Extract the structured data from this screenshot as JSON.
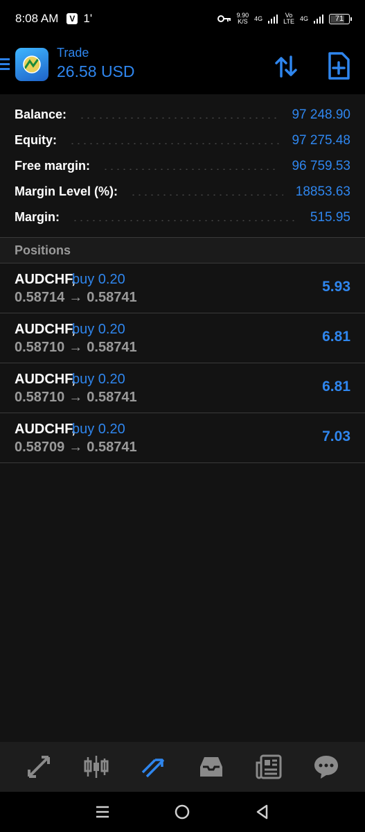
{
  "status_bar": {
    "time": "8:08 AM",
    "notif_letter": "V",
    "notif_extra": "1'",
    "net_speed": "9.90",
    "net_unit": "K/S",
    "lte_top": "Vo",
    "lte_bottom": "LTE",
    "net_4g": "4G",
    "net_4g_2": "4G",
    "battery": "71"
  },
  "app_bar": {
    "title": "Trade",
    "subtitle": "26.58 USD"
  },
  "summary": [
    {
      "label": "Balance:",
      "value": "97 248.90"
    },
    {
      "label": "Equity:",
      "value": "97 275.48"
    },
    {
      "label": "Free margin:",
      "value": "96 759.53"
    },
    {
      "label": "Margin Level (%):",
      "value": "18853.63"
    },
    {
      "label": "Margin:",
      "value": "515.95"
    }
  ],
  "positions_header": "Positions",
  "positions": [
    {
      "symbol": "AUDCHF,",
      "side": "buy 0.20",
      "open": "0.58714",
      "arrow": "→",
      "current": "0.58741",
      "profit": "5.93"
    },
    {
      "symbol": "AUDCHF,",
      "side": "buy 0.20",
      "open": "0.58710",
      "arrow": "→",
      "current": "0.58741",
      "profit": "6.81"
    },
    {
      "symbol": "AUDCHF,",
      "side": "buy 0.20",
      "open": "0.58710",
      "arrow": "→",
      "current": "0.58741",
      "profit": "6.81"
    },
    {
      "symbol": "AUDCHF,",
      "side": "buy 0.20",
      "open": "0.58709",
      "arrow": "→",
      "current": "0.58741",
      "profit": "7.03"
    }
  ],
  "tabs": [
    {
      "icon": "quotes-arrows-icon",
      "active": false
    },
    {
      "icon": "chart-candles-icon",
      "active": false
    },
    {
      "icon": "trade-icon",
      "active": true
    },
    {
      "icon": "history-inbox-icon",
      "active": false
    },
    {
      "icon": "news-icon",
      "active": false
    },
    {
      "icon": "chat-icon",
      "active": false
    }
  ],
  "colors": {
    "accent": "#2f86ee",
    "background": "#131313",
    "muted": "#9a9a9a"
  }
}
